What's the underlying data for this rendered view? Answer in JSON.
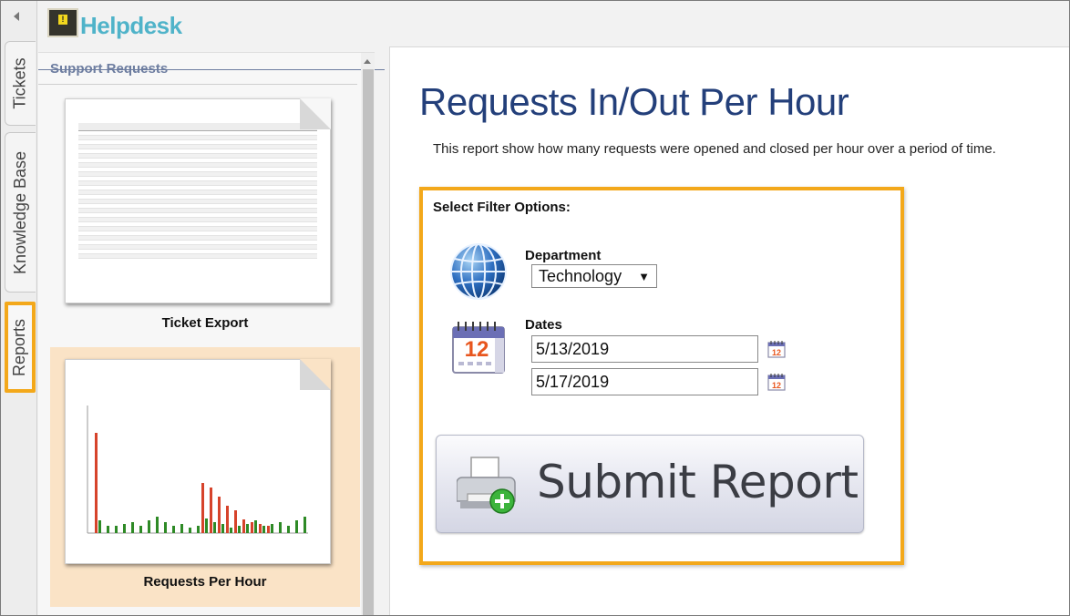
{
  "app": {
    "title": "Helpdesk"
  },
  "tabs": [
    {
      "label": "Tickets"
    },
    {
      "label": "Knowledge Base"
    },
    {
      "label": "Reports"
    }
  ],
  "sidepanel": {
    "title": "Support Requests",
    "reports": [
      {
        "label": "Ticket Export"
      },
      {
        "label": "Requests Per Hour"
      }
    ]
  },
  "main": {
    "title": "Requests In/Out Per Hour",
    "description": "This report show how many requests were opened and closed per hour over a period of time.",
    "filter": {
      "heading": "Select Filter Options:",
      "department_label": "Department",
      "department_value": "Technology",
      "dates_label": "Dates",
      "start_date": "5/13/2019",
      "end_date": "5/17/2019",
      "calendar_day": "12"
    },
    "submit_label": "Submit Report"
  },
  "colors": {
    "brand": "#4fb3c9",
    "title": "#233f7a",
    "highlight": "#f3a81a",
    "selected_card": "#fae3c6",
    "chart_in": "#d6432b",
    "chart_out": "#2e8a26"
  }
}
